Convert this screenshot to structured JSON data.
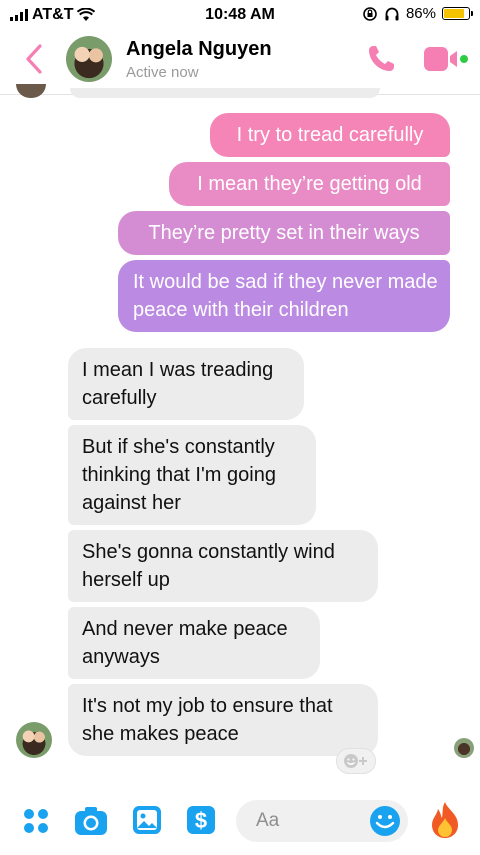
{
  "status_bar": {
    "carrier": "AT&T",
    "time": "10:48 AM",
    "battery": "86%",
    "battery_level": 0.86
  },
  "header": {
    "contact_name": "Angela Nguyen",
    "presence": "Active now"
  },
  "messages_sent": [
    "I try to tread carefully",
    "I mean they’re getting old",
    "They’re pretty set in their ways",
    "It would be sad if they never made peace with their children"
  ],
  "messages_received": [
    "I mean I was treading carefully",
    "But if she's constantly thinking that I'm going against her",
    "She's gonna constantly wind herself up",
    "And never make peace anyways",
    "It's not my job to ensure that she makes peace"
  ],
  "composer": {
    "placeholder": "Aa"
  },
  "colors": {
    "accent_pink": "#f57fb3",
    "accent_purple": "#b78be6",
    "online_green": "#2ecc40",
    "composer_blue": "#19a2f0"
  }
}
